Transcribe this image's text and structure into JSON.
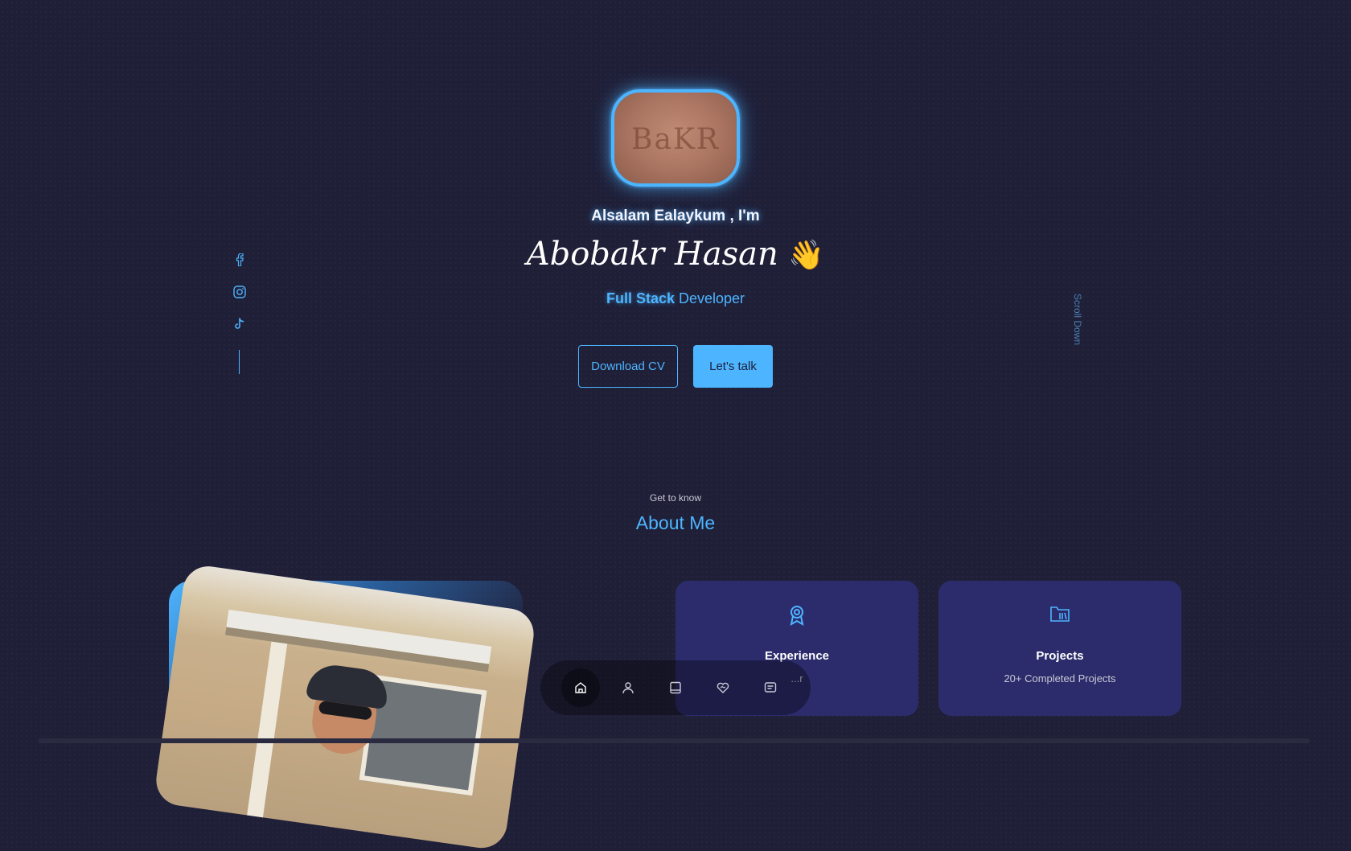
{
  "hero": {
    "greeting": "Alsalam Ealaykum , I'm",
    "name": "Abobakr Hasan",
    "wave_emoji": "👋",
    "role_strong": "Full Stack",
    "role_rest": "Developer",
    "avatar_scribble": "BaKR"
  },
  "buttons": {
    "download_cv": "Download CV",
    "lets_talk": "Let's talk"
  },
  "socials": [
    {
      "icon": "facebook-icon"
    },
    {
      "icon": "instagram-icon"
    },
    {
      "icon": "tiktok-icon"
    }
  ],
  "scroll_down": "Scroll Down",
  "about": {
    "kicker": "Get to know",
    "title": "About Me"
  },
  "cards": {
    "experience": {
      "title": "Experience",
      "subtitle": "...r",
      "icon": "award-icon"
    },
    "projects": {
      "title": "Projects",
      "subtitle": "20+ Completed Projects",
      "icon": "folder-icon"
    }
  },
  "nav": [
    "home-icon",
    "user-icon",
    "book-icon",
    "heart-handshake-icon",
    "message-icon"
  ],
  "colors": {
    "background": "#1f1f38",
    "accent": "#4db5ff",
    "card": "#2c2c6c"
  }
}
